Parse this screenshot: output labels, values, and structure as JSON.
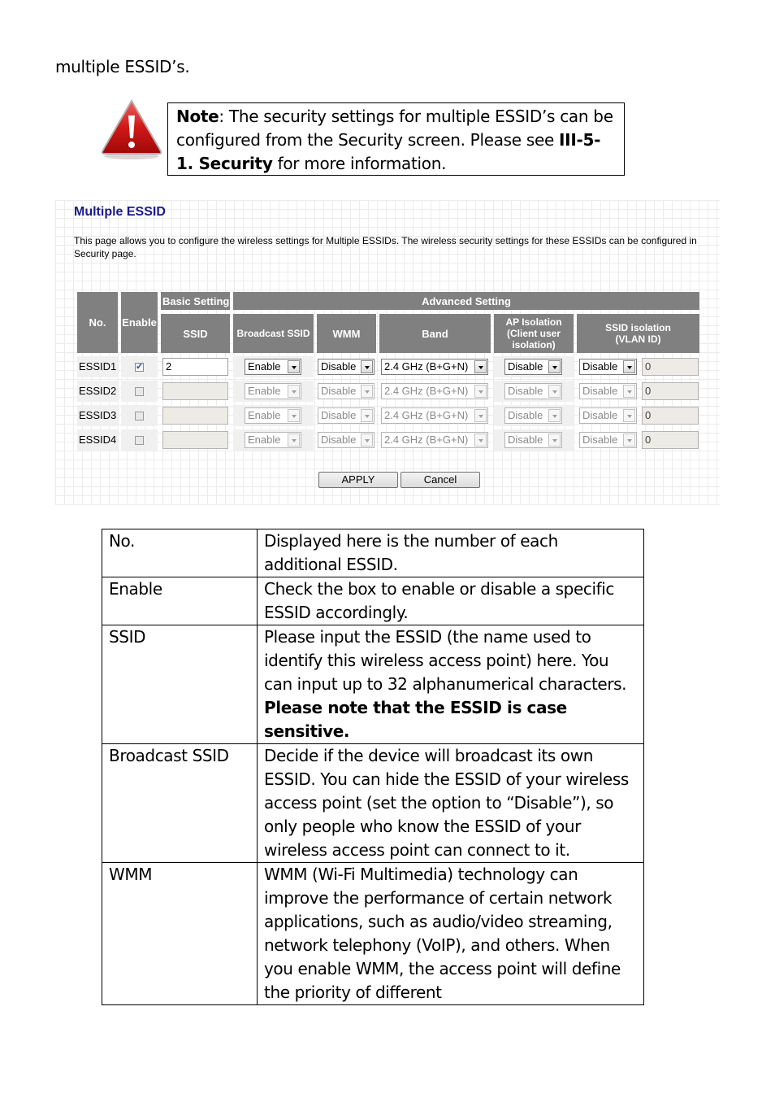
{
  "intro": {
    "text": "multiple ESSID’s."
  },
  "note": {
    "icon": "warning-triangle-icon",
    "label": "Note",
    "text1": ": The security settings for multiple ESSID’s can be configured from the Security screen. Please see ",
    "link": "III-5-1. Security",
    "text2": " for more information."
  },
  "panel": {
    "title": "Multiple ESSID",
    "description": "This page allows you to configure the wireless settings for Multiple ESSIDs. The wireless security settings for these ESSIDs can be configured in Security page.",
    "headers": {
      "no": "No.",
      "enable": "Enable",
      "basic_setting": "Basic Setting",
      "advanced_setting": "Advanced Setting",
      "ssid": "SSID",
      "broadcast_ssid": "Broadcast SSID",
      "wmm": "WMM",
      "band": "Band",
      "ap_isolation_1": "AP Isolation",
      "ap_isolation_2": "(Client user",
      "ap_isolation_3": "isolation)",
      "ssid_isolation_1": "SSID isolation",
      "ssid_isolation_2": "(VLAN ID)"
    },
    "rows": [
      {
        "no": "ESSID1",
        "enabled": true,
        "ssid": "2",
        "broadcast": "Enable",
        "wmm": "Disable",
        "band": "2.4 GHz (B+G+N)",
        "ap_isolation": "Disable",
        "ssid_isolation": "Disable",
        "vlan_id": "0"
      },
      {
        "no": "ESSID2",
        "enabled": false,
        "ssid": "",
        "broadcast": "Enable",
        "wmm": "Disable",
        "band": "2.4 GHz (B+G+N)",
        "ap_isolation": "Disable",
        "ssid_isolation": "Disable",
        "vlan_id": "0"
      },
      {
        "no": "ESSID3",
        "enabled": false,
        "ssid": "",
        "broadcast": "Enable",
        "wmm": "Disable",
        "band": "2.4 GHz (B+G+N)",
        "ap_isolation": "Disable",
        "ssid_isolation": "Disable",
        "vlan_id": "0"
      },
      {
        "no": "ESSID4",
        "enabled": false,
        "ssid": "",
        "broadcast": "Enable",
        "wmm": "Disable",
        "band": "2.4 GHz (B+G+N)",
        "ap_isolation": "Disable",
        "ssid_isolation": "Disable",
        "vlan_id": "0"
      }
    ],
    "buttons": {
      "apply": "APPLY",
      "cancel": "Cancel"
    }
  },
  "descriptions": [
    {
      "term": "No.",
      "definition": "Displayed here is the number of each additional ESSID.",
      "bold": ""
    },
    {
      "term": "Enable",
      "definition": "Check the box to enable or disable a specific ESSID accordingly.",
      "bold": ""
    },
    {
      "term": "SSID",
      "definition": "Please input the ESSID (the name used to identify this wireless access point) here. You can input up to 32 alphanumerical characters. ",
      "bold": "Please note that the ESSID is case sensitive."
    },
    {
      "term": "Broadcast SSID",
      "definition": "Decide if the device will broadcast its own ESSID. You can hide the ESSID of your wireless access point (set the option to “Disable”), so only people who know the ESSID of your wireless access point can connect to it.",
      "bold": ""
    },
    {
      "term": "WMM",
      "definition": "WMM (Wi-Fi Multimedia) technology can improve the performance of certain network applications, such as audio/video streaming, network telephony (VoIP), and others. When you enable WMM, the access point will define the priority of different",
      "bold": ""
    }
  ]
}
